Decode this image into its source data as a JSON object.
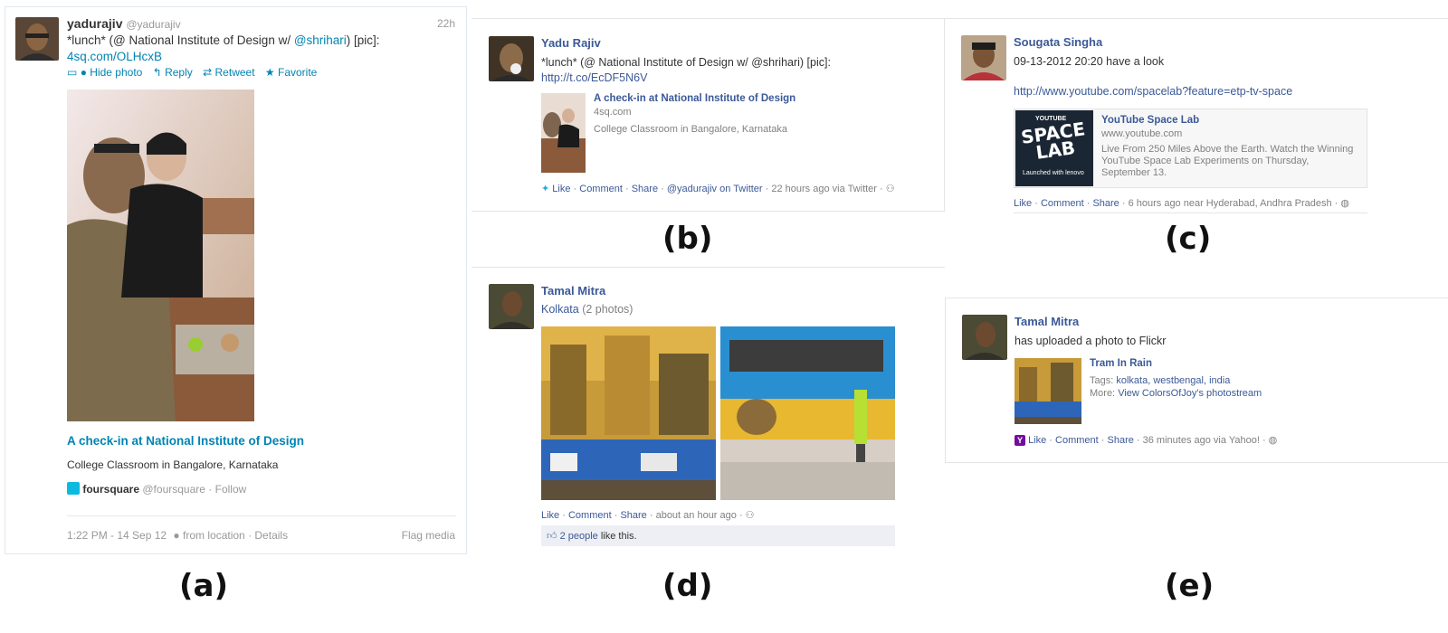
{
  "panel_a": {
    "name": "yadurajiv",
    "handle": "@yadurajiv",
    "time": "22h",
    "text_prefix": "*lunch* (@ National Institute of Design w/ ",
    "mention": "@shrihari",
    "text_suffix": ") [pic]:",
    "link": "4sq.com/OLHcxB",
    "actions": {
      "hide_photo": "Hide photo",
      "reply": "Reply",
      "retweet": "Retweet",
      "favorite": "Favorite"
    },
    "checkin_title": "A check-in at National Institute of Design",
    "checkin_desc": "College Classroom in Bangalore, Karnataka",
    "fsq_name": "foursquare",
    "fsq_handle": "@foursquare",
    "fsq_follow": "· Follow",
    "footer": {
      "datetime": "1:22 PM - 14 Sep 12",
      "location": "from location",
      "details": "· Details",
      "flag": "Flag media"
    }
  },
  "panel_b": {
    "name": "Yadu Rajiv",
    "text": "*lunch* (@ National Institute of Design w/ @shrihari) [pic]:",
    "link": "http://t.co/EcDF5N6V",
    "attach_title": "A check-in at National Institute of Design",
    "attach_domain": "4sq.com",
    "attach_desc": "College Classroom in Bangalore, Karnataka",
    "actions": {
      "like": "Like",
      "comment": "Comment",
      "share": "Share",
      "twitter": "@yadurajiv on Twitter",
      "meta": "22 hours ago via Twitter"
    }
  },
  "panel_c": {
    "name": "Sougata Singha",
    "text": "09-13-2012 20:20 have a look",
    "link": "http://www.youtube.com/spacelab?feature=etp-tv-space",
    "thumb_top": "YOUTUBE",
    "thumb_main": "SPACE LAB",
    "thumb_bottom": "Launched with lenovo",
    "attach_title": "YouTube Space Lab",
    "attach_domain": "www.youtube.com",
    "attach_desc": "Live From 250 Miles Above the Earth. Watch the Winning YouTube Space Lab Experiments on Thursday, September 13.",
    "actions": {
      "like": "Like",
      "comment": "Comment",
      "share": "Share",
      "meta": "6 hours ago near Hyderabad, Andhra Pradesh"
    }
  },
  "panel_d": {
    "name": "Tamal Mitra",
    "album": "Kolkata",
    "album_count": "(2 photos)",
    "actions": {
      "like": "Like",
      "comment": "Comment",
      "share": "Share",
      "meta": "about an hour ago"
    },
    "likes_count": "2 people",
    "likes_suffix": "like this."
  },
  "panel_e": {
    "name": "Tamal Mitra",
    "text": "has uploaded a photo to Flickr",
    "photo_title": "Tram In Rain",
    "tags_label": "Tags:",
    "tags": "kolkata, westbengal, india",
    "more_label": "More:",
    "more_link": "View ColorsOfJoy's photostream",
    "actions": {
      "like": "Like",
      "comment": "Comment",
      "share": "Share",
      "meta": "36 minutes ago via Yahoo!"
    }
  },
  "captions": {
    "a": "(a)",
    "b": "(b)",
    "c": "(c)",
    "d": "(d)",
    "e": "(e)"
  },
  "colors": {
    "twitter_blue": "#0084b4",
    "facebook_blue": "#3b5998",
    "gray_text": "#808080"
  }
}
